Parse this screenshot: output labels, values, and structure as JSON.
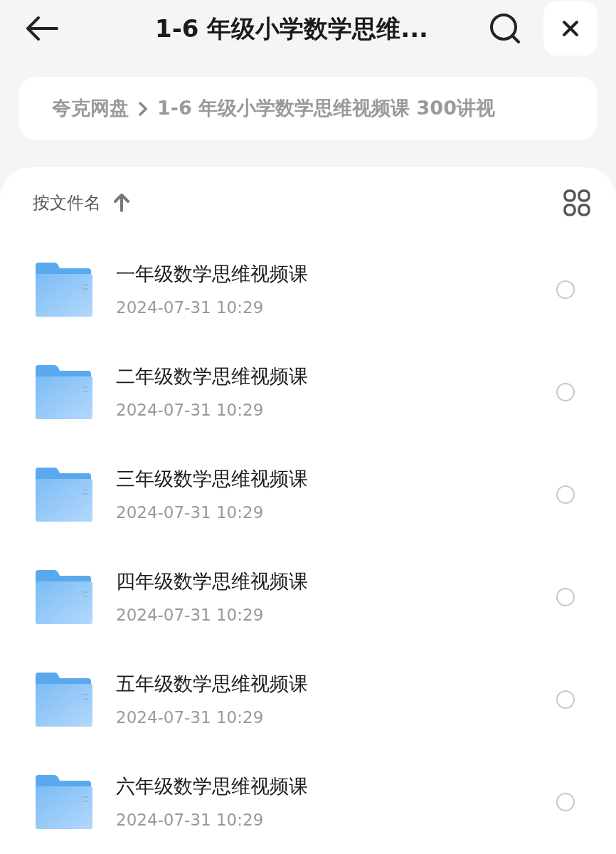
{
  "header": {
    "title": "1-6 年级小学数学思维..."
  },
  "breadcrumb": [
    {
      "label": "夸克网盘"
    },
    {
      "label": "1-6 年级小学数学思维视频课 300讲视"
    }
  ],
  "sort": {
    "label": "按文件名"
  },
  "files": [
    {
      "name": "一年级数学思维视频课",
      "date": "2024-07-31 10:29",
      "selected": false
    },
    {
      "name": "二年级数学思维视频课",
      "date": "2024-07-31 10:29",
      "selected": false
    },
    {
      "name": "三年级数学思维视频课",
      "date": "2024-07-31 10:29",
      "selected": false
    },
    {
      "name": "四年级数学思维视频课",
      "date": "2024-07-31 10:29",
      "selected": false
    },
    {
      "name": "五年级数学思维视频课",
      "date": "2024-07-31 10:29",
      "selected": false
    },
    {
      "name": "六年级数学思维视频课",
      "date": "2024-07-31 10:29",
      "selected": false
    }
  ]
}
